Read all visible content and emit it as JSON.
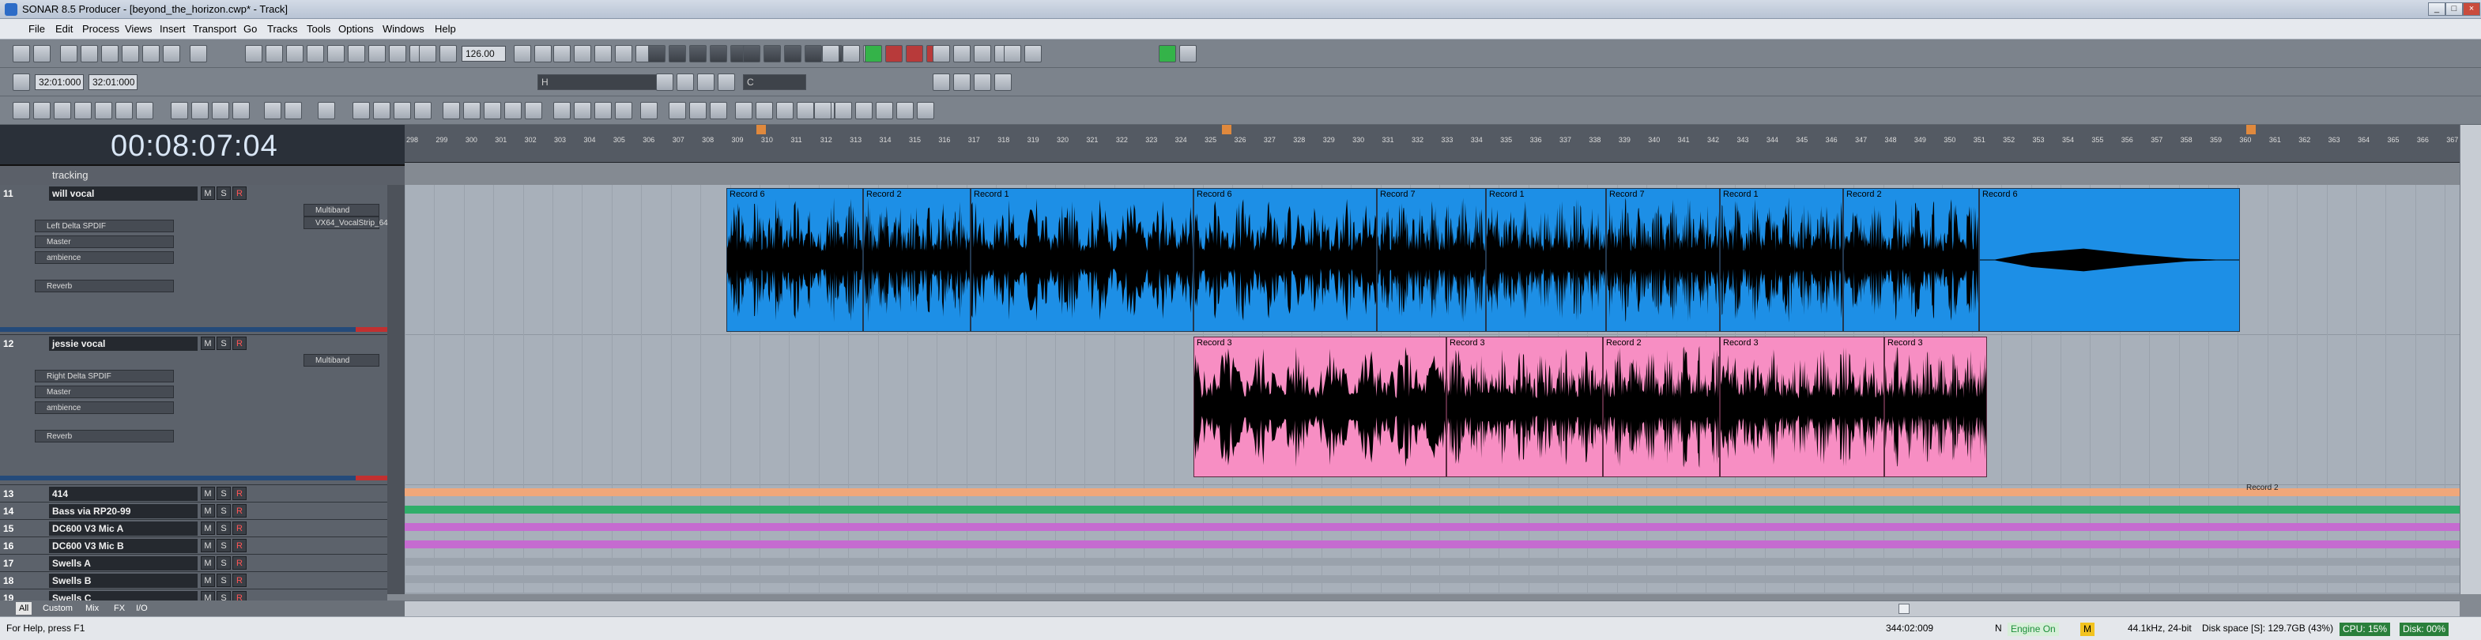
{
  "window": {
    "title": "SONAR 8.5 Producer - [beyond_the_horizon.cwp* - Track]",
    "controls": [
      "_",
      "□",
      "×"
    ]
  },
  "menu": [
    "File",
    "Edit",
    "Process",
    "Views",
    "Insert",
    "Transport",
    "Go",
    "Tracks",
    "Tools",
    "Options",
    "Windows",
    "Help"
  ],
  "toolbar": {
    "tempo": "126.00",
    "time_start": "32:01:000",
    "time_end": "32:01:000",
    "key_field": "H",
    "key_field2": "C"
  },
  "clock": "00:08:07:04",
  "track_folder": "tracking",
  "tracks": [
    {
      "num": "11",
      "name": "will vocal",
      "input": "Left Delta SPDIF",
      "output": "Master",
      "send1": "ambience",
      "send2": "Reverb",
      "insert": "Multiband",
      "fx": "VX64_VocalStrip_64"
    },
    {
      "num": "12",
      "name": "jessie vocal",
      "input": "Right Delta SPDIF",
      "output": "Master",
      "send1": "ambience",
      "send2": "Reverb",
      "insert": "Multiband"
    },
    {
      "num": "13",
      "name": "414"
    },
    {
      "num": "14",
      "name": "Bass via RP20-99"
    },
    {
      "num": "15",
      "name": "DC600 V3 Mic A"
    },
    {
      "num": "16",
      "name": "DC600 V3 Mic B"
    },
    {
      "num": "17",
      "name": "Swells A"
    },
    {
      "num": "18",
      "name": "Swells B"
    },
    {
      "num": "19",
      "name": "Swells C"
    }
  ],
  "track_buttons": [
    "M",
    "S",
    "R"
  ],
  "ruler": {
    "bars": [
      "298",
      "299",
      "300",
      "301",
      "302",
      "303",
      "304",
      "305",
      "306",
      "307",
      "308",
      "309",
      "310",
      "311",
      "312",
      "313",
      "314",
      "315",
      "316",
      "317",
      "318",
      "319",
      "320",
      "321",
      "322",
      "323",
      "324",
      "325",
      "326",
      "327",
      "328",
      "329",
      "330",
      "331",
      "332",
      "333",
      "334",
      "335",
      "336",
      "337",
      "338",
      "339",
      "340",
      "341",
      "342",
      "343",
      "344",
      "345",
      "346",
      "347",
      "348",
      "349",
      "350",
      "351",
      "352",
      "353",
      "354",
      "355",
      "356",
      "357",
      "358",
      "359",
      "360",
      "361",
      "362",
      "363",
      "364",
      "365",
      "366",
      "367"
    ]
  },
  "clips_track11": [
    "Record 6",
    "Record 2",
    "Record 1",
    "Record 6",
    "Record 7",
    "Record 1",
    "Record 7",
    "Record 1",
    "Record 2",
    "Record 6"
  ],
  "clips_track12": [
    "Record 3",
    "Record 3",
    "Record 2",
    "Record 3",
    "Record 3"
  ],
  "clip_label_small": "Record 2",
  "bottom_tabs": [
    "All",
    "Custom",
    "Mix",
    "FX",
    "I/O"
  ],
  "status": {
    "help": "For Help, press F1",
    "position": "344:02:009",
    "n": "N",
    "engine": "Engine On",
    "m": "M",
    "format": "44.1kHz, 24-bit",
    "disk": "Disk space [S]: 129.7GB (43%)",
    "cpu": "CPU: 15%",
    "disk_pct": "Disk: 00%"
  },
  "colors": {
    "clip_blue": "#1d8fe6",
    "clip_pink": "#f78ec3",
    "engine_on": "#1d8f3a"
  }
}
